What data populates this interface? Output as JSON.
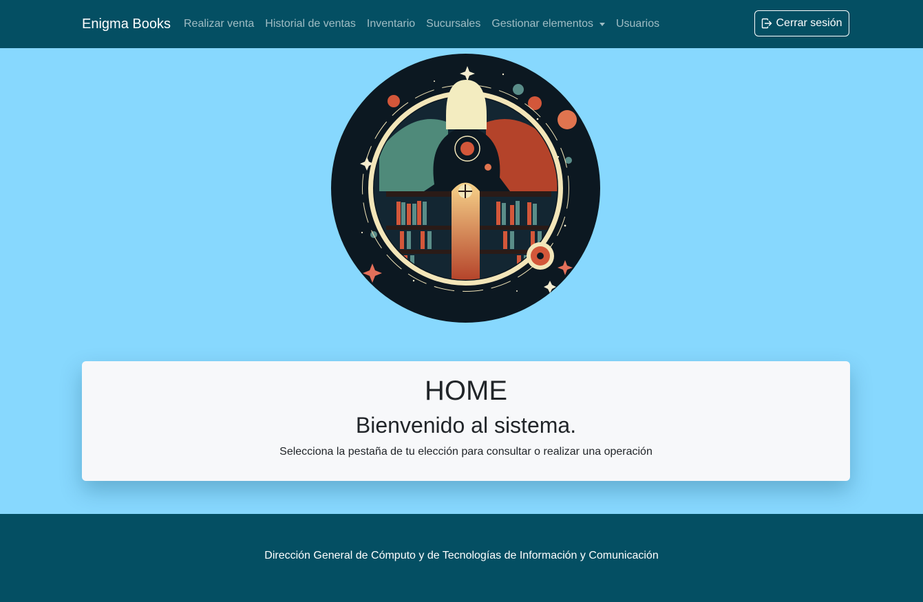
{
  "navbar": {
    "brand": "Enigma Books",
    "links": [
      {
        "label": "Realizar venta"
      },
      {
        "label": "Historial de ventas"
      },
      {
        "label": "Inventario"
      },
      {
        "label": "Sucursales"
      },
      {
        "label": "Gestionar elementos",
        "dropdown": true
      },
      {
        "label": "Usuarios"
      }
    ],
    "logout_label": "Cerrar sesión",
    "logout_icon": "box-arrow-right-icon"
  },
  "hero": {
    "logo_icon": "library-observatory-logo"
  },
  "card": {
    "title": "HOME",
    "subtitle": "Bienvenido al sistema.",
    "description": "Selecciona la pestaña de tu elección para consultar o realizar una operación"
  },
  "footer": {
    "text": "Dirección General de Cómputo y de Tecnologías de Información y Comunicación"
  },
  "colors": {
    "navbar_bg": "#044f63",
    "page_bg": "#87d8fe",
    "card_bg": "#f7f8fa"
  }
}
